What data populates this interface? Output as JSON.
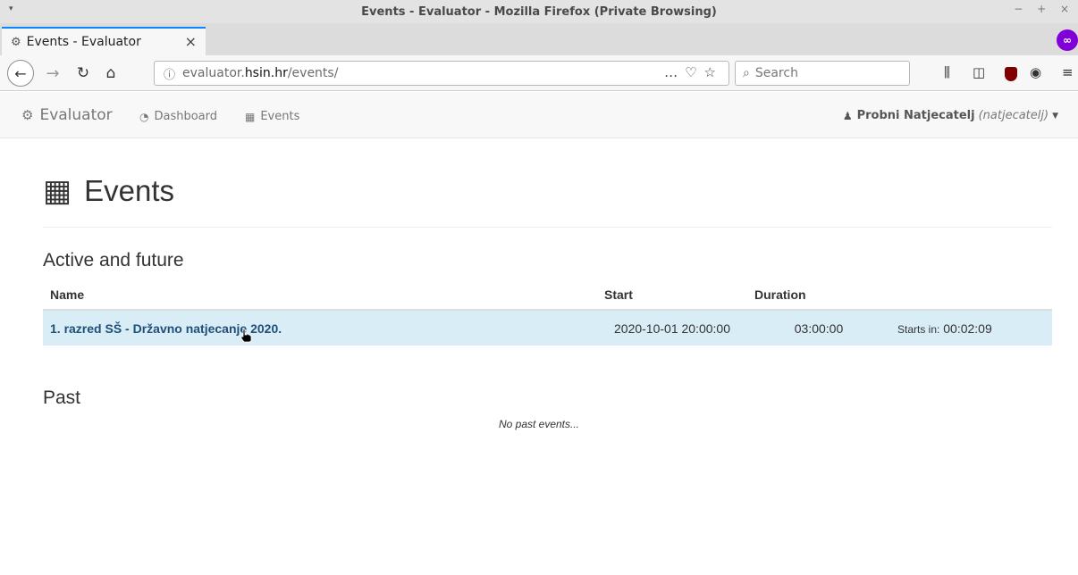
{
  "window": {
    "title": "Events - Evaluator - Mozilla Firefox (Private Browsing)",
    "controls": "− + ×"
  },
  "tabs": [
    {
      "label": "Events - Evaluator",
      "icon": "gears-icon"
    }
  ],
  "browser": {
    "url_prefix": "evaluator.",
    "url_host": "hsin.hr",
    "url_path": "/events/",
    "search_placeholder": "Search",
    "private_color": "#8000d7",
    "accent": "#0a84ff"
  },
  "site": {
    "brand": "Evaluator",
    "nav": [
      {
        "label": "Dashboard",
        "icon": "tachometer-icon"
      },
      {
        "label": "Events",
        "icon": "calendar-icon"
      }
    ],
    "user": {
      "name": "Probni Natjecatelj",
      "handle": "(natjecatelj)"
    }
  },
  "page": {
    "title": "Events",
    "active_section": "Active and future",
    "past_section": "Past",
    "no_past": "No past events...",
    "columns": [
      "Name",
      "Start",
      "Duration"
    ],
    "events": [
      {
        "name": "1. razred SŠ - Državno natjecanje 2020.",
        "start": "2020-10-01 20:00:00",
        "duration": "03:00:00",
        "countdown_label": "Starts in:",
        "countdown": "00:02:09"
      }
    ],
    "row_highlight": "#d9edf7",
    "link_color": "#1f4e79"
  }
}
